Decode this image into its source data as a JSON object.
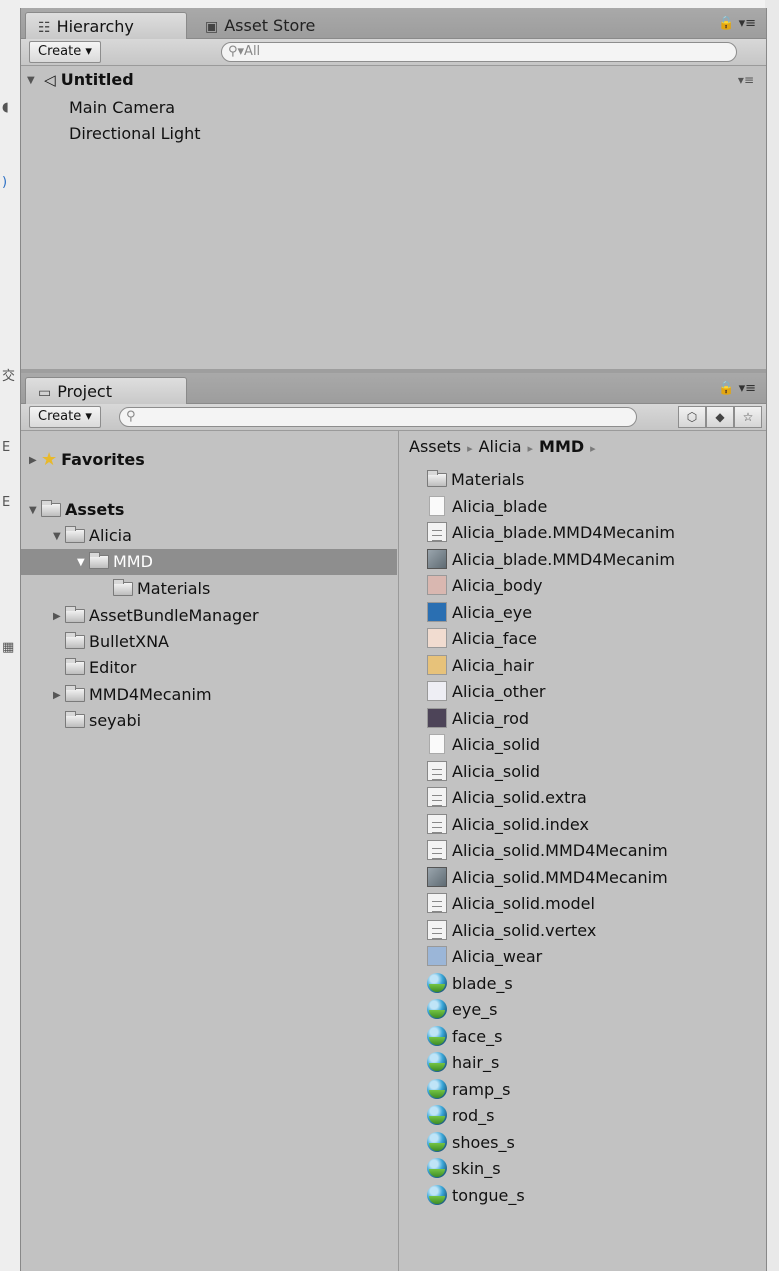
{
  "hierarchy": {
    "tabs": [
      {
        "label": "Hierarchy",
        "icon": "list-icon",
        "active": true
      },
      {
        "label": "Asset Store",
        "icon": "store-icon",
        "active": false
      }
    ],
    "create_label": "Create",
    "search_placeholder": "All",
    "scene_name": "Untitled",
    "items": [
      "Main Camera",
      "Directional Light"
    ]
  },
  "project": {
    "tab_label": "Project",
    "create_label": "Create",
    "tree": [
      {
        "label": "Favorites",
        "type": "favorites",
        "indent": 0,
        "arrow": "right",
        "bold": true
      },
      {
        "label": "Assets",
        "type": "folder",
        "indent": 0,
        "arrow": "down",
        "bold": true
      },
      {
        "label": "Alicia",
        "type": "folder",
        "indent": 1,
        "arrow": "down"
      },
      {
        "label": "MMD",
        "type": "folder",
        "indent": 2,
        "arrow": "down",
        "selected": true
      },
      {
        "label": "Materials",
        "type": "folder",
        "indent": 3,
        "arrow": ""
      },
      {
        "label": "AssetBundleManager",
        "type": "folder",
        "indent": 1,
        "arrow": "right"
      },
      {
        "label": "BulletXNA",
        "type": "folder",
        "indent": 1,
        "arrow": ""
      },
      {
        "label": "Editor",
        "type": "folder",
        "indent": 1,
        "arrow": ""
      },
      {
        "label": "MMD4Mecanim",
        "type": "folder",
        "indent": 1,
        "arrow": "right"
      },
      {
        "label": "seyabi",
        "type": "folder",
        "indent": 1,
        "arrow": ""
      }
    ],
    "breadcrumb": [
      "Assets",
      "Alicia",
      "MMD"
    ],
    "assets": [
      {
        "label": "Materials",
        "icon": "folder"
      },
      {
        "label": "Alicia_blade",
        "icon": "blank"
      },
      {
        "label": "Alicia_blade.MMD4Mecanim",
        "icon": "text"
      },
      {
        "label": "Alicia_blade.MMD4Mecanim",
        "icon": "prefab"
      },
      {
        "label": "Alicia_body",
        "icon": "tex",
        "color": "#d9b7b0"
      },
      {
        "label": "Alicia_eye",
        "icon": "tex",
        "color": "#2a6fb2"
      },
      {
        "label": "Alicia_face",
        "icon": "tex",
        "color": "#f1dcd0"
      },
      {
        "label": "Alicia_hair",
        "icon": "tex",
        "color": "#e7c27a"
      },
      {
        "label": "Alicia_other",
        "icon": "tex",
        "color": "#eeeef4"
      },
      {
        "label": "Alicia_rod",
        "icon": "tex",
        "color": "#4d4458"
      },
      {
        "label": "Alicia_solid",
        "icon": "blank"
      },
      {
        "label": "Alicia_solid",
        "icon": "text"
      },
      {
        "label": "Alicia_solid.extra",
        "icon": "text"
      },
      {
        "label": "Alicia_solid.index",
        "icon": "text"
      },
      {
        "label": "Alicia_solid.MMD4Mecanim",
        "icon": "text"
      },
      {
        "label": "Alicia_solid.MMD4Mecanim",
        "icon": "prefab"
      },
      {
        "label": "Alicia_solid.model",
        "icon": "text"
      },
      {
        "label": "Alicia_solid.vertex",
        "icon": "text"
      },
      {
        "label": "Alicia_wear",
        "icon": "tex",
        "color": "#9bb6d8"
      },
      {
        "label": "blade_s",
        "icon": "material"
      },
      {
        "label": "eye_s",
        "icon": "material"
      },
      {
        "label": "face_s",
        "icon": "material"
      },
      {
        "label": "hair_s",
        "icon": "material"
      },
      {
        "label": "ramp_s",
        "icon": "material"
      },
      {
        "label": "rod_s",
        "icon": "material"
      },
      {
        "label": "shoes_s",
        "icon": "material"
      },
      {
        "label": "skin_s",
        "icon": "material"
      },
      {
        "label": "tongue_s",
        "icon": "material"
      }
    ]
  }
}
